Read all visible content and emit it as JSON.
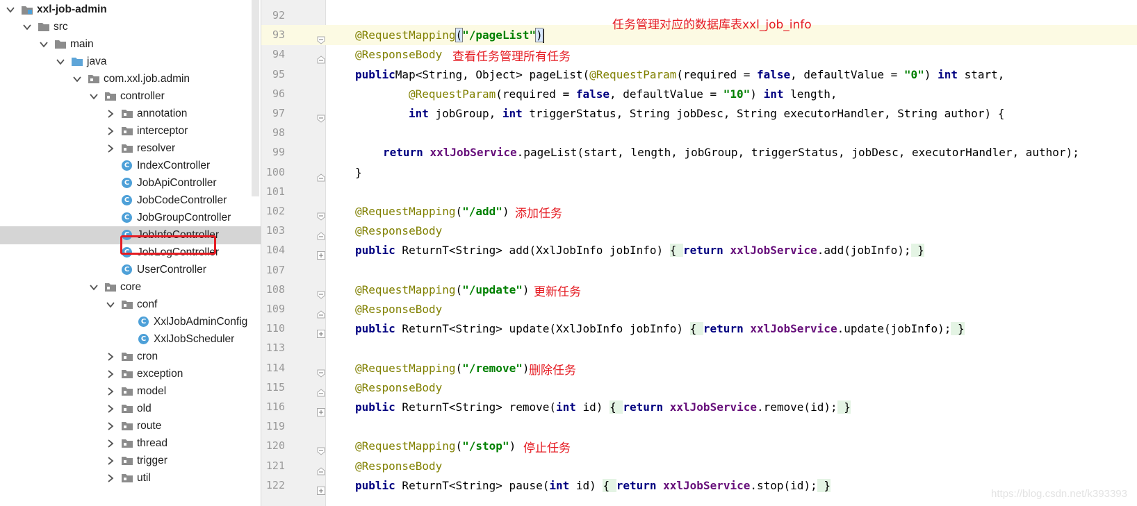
{
  "tree": {
    "items": [
      {
        "label": "xxl-job-admin",
        "depth": 0,
        "arrow": "down",
        "icon": "module",
        "bold": true
      },
      {
        "label": "src",
        "depth": 1,
        "arrow": "down",
        "icon": "folder"
      },
      {
        "label": "main",
        "depth": 2,
        "arrow": "down",
        "icon": "folder"
      },
      {
        "label": "java",
        "depth": 3,
        "arrow": "down",
        "icon": "source-folder"
      },
      {
        "label": "com.xxl.job.admin",
        "depth": 4,
        "arrow": "down",
        "icon": "package"
      },
      {
        "label": "controller",
        "depth": 5,
        "arrow": "down",
        "icon": "package"
      },
      {
        "label": "annotation",
        "depth": 6,
        "arrow": "right",
        "icon": "package"
      },
      {
        "label": "interceptor",
        "depth": 6,
        "arrow": "right",
        "icon": "package"
      },
      {
        "label": "resolver",
        "depth": 6,
        "arrow": "right",
        "icon": "package"
      },
      {
        "label": "IndexController",
        "depth": 6,
        "arrow": "none",
        "icon": "class"
      },
      {
        "label": "JobApiController",
        "depth": 6,
        "arrow": "none",
        "icon": "class"
      },
      {
        "label": "JobCodeController",
        "depth": 6,
        "arrow": "none",
        "icon": "class"
      },
      {
        "label": "JobGroupController",
        "depth": 6,
        "arrow": "none",
        "icon": "class"
      },
      {
        "label": "JobInfoController",
        "depth": 6,
        "arrow": "none",
        "icon": "class",
        "selected": true
      },
      {
        "label": "JobLogController",
        "depth": 6,
        "arrow": "none",
        "icon": "class"
      },
      {
        "label": "UserController",
        "depth": 6,
        "arrow": "none",
        "icon": "class"
      },
      {
        "label": "core",
        "depth": 5,
        "arrow": "down",
        "icon": "package"
      },
      {
        "label": "conf",
        "depth": 6,
        "arrow": "down",
        "icon": "package"
      },
      {
        "label": "XxlJobAdminConfig",
        "depth": 7,
        "arrow": "none",
        "icon": "class"
      },
      {
        "label": "XxlJobScheduler",
        "depth": 7,
        "arrow": "none",
        "icon": "class"
      },
      {
        "label": "cron",
        "depth": 6,
        "arrow": "right",
        "icon": "package"
      },
      {
        "label": "exception",
        "depth": 6,
        "arrow": "right",
        "icon": "package"
      },
      {
        "label": "model",
        "depth": 6,
        "arrow": "right",
        "icon": "package"
      },
      {
        "label": "old",
        "depth": 6,
        "arrow": "right",
        "icon": "package"
      },
      {
        "label": "route",
        "depth": 6,
        "arrow": "right",
        "icon": "package"
      },
      {
        "label": "thread",
        "depth": 6,
        "arrow": "right",
        "icon": "package"
      },
      {
        "label": "trigger",
        "depth": 6,
        "arrow": "right",
        "icon": "package"
      },
      {
        "label": "util",
        "depth": 6,
        "arrow": "right",
        "icon": "package"
      }
    ]
  },
  "editor": {
    "lines": [
      {
        "n": "92",
        "fold": "",
        "indent": 0,
        "tokens": []
      },
      {
        "n": "93",
        "fold": "open",
        "indent": 1,
        "current": true,
        "tokens": [
          [
            "an",
            "@RequestMapping"
          ],
          [
            "cur",
            "("
          ],
          [
            "st",
            "\"/pageList\""
          ],
          [
            "cur",
            ")"
          ],
          [
            "caret",
            ""
          ]
        ]
      },
      {
        "n": "94",
        "fold": "close",
        "indent": 1,
        "tokens": [
          [
            "an",
            "@ResponseBody"
          ]
        ]
      },
      {
        "n": "95",
        "fold": "",
        "indent": 1,
        "tokens": [
          [
            "k",
            "public"
          ],
          [
            "",
            "Map<String, Object> pageList("
          ],
          [
            "an",
            "@RequestParam"
          ],
          [
            "",
            "(required = "
          ],
          [
            "k",
            "false"
          ],
          [
            "",
            ", defaultValue = "
          ],
          [
            "st",
            "\"0\""
          ],
          [
            "",
            ") "
          ],
          [
            "k",
            "int"
          ],
          [
            "",
            " start,"
          ]
        ]
      },
      {
        "n": "96",
        "fold": "",
        "indent": 3,
        "tokens": [
          [
            "an",
            "@RequestParam"
          ],
          [
            "",
            "(required = "
          ],
          [
            "k",
            "false"
          ],
          [
            "",
            ", defaultValue = "
          ],
          [
            "st",
            "\"10\""
          ],
          [
            "",
            ") "
          ],
          [
            "k",
            "int"
          ],
          [
            "",
            " length,"
          ]
        ]
      },
      {
        "n": "97",
        "fold": "open",
        "indent": 3,
        "tokens": [
          [
            "k",
            "int"
          ],
          [
            "",
            " jobGroup, "
          ],
          [
            "k",
            "int"
          ],
          [
            "",
            " triggerStatus, String jobDesc, String executorHandler, String author) {"
          ]
        ]
      },
      {
        "n": "98",
        "fold": "",
        "indent": 0,
        "tokens": []
      },
      {
        "n": "99",
        "fold": "",
        "indent": 2,
        "tokens": [
          [
            "k",
            "return"
          ],
          [
            "",
            " "
          ],
          [
            "fd",
            "xxlJobService"
          ],
          [
            "",
            ".pageList(start, length, jobGroup, triggerStatus, jobDesc, executorHandler, author);"
          ]
        ]
      },
      {
        "n": "100",
        "fold": "close",
        "indent": 1,
        "tokens": [
          [
            "",
            "}"
          ]
        ]
      },
      {
        "n": "101",
        "fold": "",
        "indent": 0,
        "tokens": []
      },
      {
        "n": "102",
        "fold": "open",
        "indent": 1,
        "tokens": [
          [
            "an",
            "@RequestMapping"
          ],
          [
            "",
            "("
          ],
          [
            "st",
            "\"/add\""
          ],
          [
            "",
            ")"
          ]
        ]
      },
      {
        "n": "103",
        "fold": "close",
        "indent": 1,
        "tokens": [
          [
            "an",
            "@ResponseBody"
          ]
        ]
      },
      {
        "n": "104",
        "fold": "plus",
        "indent": 1,
        "tokens": [
          [
            "k",
            "public"
          ],
          [
            "",
            " ReturnT<String> add(XxlJobInfo jobInfo) "
          ],
          [
            "fb",
            "{ "
          ],
          [
            "k",
            "return"
          ],
          [
            "",
            " "
          ],
          [
            "fd",
            "xxlJobService"
          ],
          [
            "",
            ".add(jobInfo);"
          ],
          [
            "fb",
            " }"
          ]
        ]
      },
      {
        "n": "107",
        "fold": "",
        "indent": 0,
        "tokens": []
      },
      {
        "n": "108",
        "fold": "open",
        "indent": 1,
        "tokens": [
          [
            "an",
            "@RequestMapping"
          ],
          [
            "",
            "("
          ],
          [
            "st",
            "\"/update\""
          ],
          [
            "",
            ")"
          ]
        ]
      },
      {
        "n": "109",
        "fold": "close",
        "indent": 1,
        "tokens": [
          [
            "an",
            "@ResponseBody"
          ]
        ]
      },
      {
        "n": "110",
        "fold": "plus",
        "indent": 1,
        "tokens": [
          [
            "k",
            "public"
          ],
          [
            "",
            " ReturnT<String> update(XxlJobInfo jobInfo) "
          ],
          [
            "fb",
            "{ "
          ],
          [
            "k",
            "return"
          ],
          [
            "",
            " "
          ],
          [
            "fd",
            "xxlJobService"
          ],
          [
            "",
            ".update(jobInfo);"
          ],
          [
            "fb",
            " }"
          ]
        ]
      },
      {
        "n": "113",
        "fold": "",
        "indent": 0,
        "tokens": []
      },
      {
        "n": "114",
        "fold": "open",
        "indent": 1,
        "tokens": [
          [
            "an",
            "@RequestMapping"
          ],
          [
            "",
            "("
          ],
          [
            "st",
            "\"/remove\""
          ],
          [
            "",
            ")"
          ]
        ]
      },
      {
        "n": "115",
        "fold": "close",
        "indent": 1,
        "tokens": [
          [
            "an",
            "@ResponseBody"
          ]
        ]
      },
      {
        "n": "116",
        "fold": "plus",
        "indent": 1,
        "tokens": [
          [
            "k",
            "public"
          ],
          [
            "",
            " ReturnT<String> remove("
          ],
          [
            "k",
            "int"
          ],
          [
            "",
            " id) "
          ],
          [
            "fb",
            "{ "
          ],
          [
            "k",
            "return"
          ],
          [
            "",
            " "
          ],
          [
            "fd",
            "xxlJobService"
          ],
          [
            "",
            ".remove(id);"
          ],
          [
            "fb",
            " }"
          ]
        ]
      },
      {
        "n": "119",
        "fold": "",
        "indent": 0,
        "tokens": []
      },
      {
        "n": "120",
        "fold": "open",
        "indent": 1,
        "tokens": [
          [
            "an",
            "@RequestMapping"
          ],
          [
            "",
            "("
          ],
          [
            "st",
            "\"/stop\""
          ],
          [
            "",
            ")"
          ]
        ]
      },
      {
        "n": "121",
        "fold": "close",
        "indent": 1,
        "tokens": [
          [
            "an",
            "@ResponseBody"
          ]
        ]
      },
      {
        "n": "122",
        "fold": "plus",
        "indent": 1,
        "tokens": [
          [
            "k",
            "public"
          ],
          [
            "",
            " ReturnT<String> pause("
          ],
          [
            "k",
            "int"
          ],
          [
            "",
            " id) "
          ],
          [
            "fb",
            "{ "
          ],
          [
            "k",
            "return"
          ],
          [
            "",
            " "
          ],
          [
            "fd",
            "xxlJobService"
          ],
          [
            "",
            ".stop(id);"
          ],
          [
            "fb",
            " }"
          ]
        ]
      }
    ],
    "annotations": [
      {
        "text": "任务管理对应的数据库表xxl_job_info",
        "line": "93"
      },
      {
        "text": "查看任务管理所有任务",
        "line": "94"
      },
      {
        "text": "添加任务",
        "line": "102"
      },
      {
        "text": "更新任务",
        "line": "108"
      },
      {
        "text": "删除任务",
        "line": "114"
      },
      {
        "text": "停止任务",
        "line": "120"
      }
    ]
  },
  "watermark": "https://blog.csdn.net/k393393",
  "colors": {
    "keyword": "#000080",
    "annotation": "#808000",
    "string": "#008000",
    "field": "#660e7a",
    "note": "#e51c23",
    "selection": "#d5d5d5",
    "class_icon": "#4da0d8"
  }
}
